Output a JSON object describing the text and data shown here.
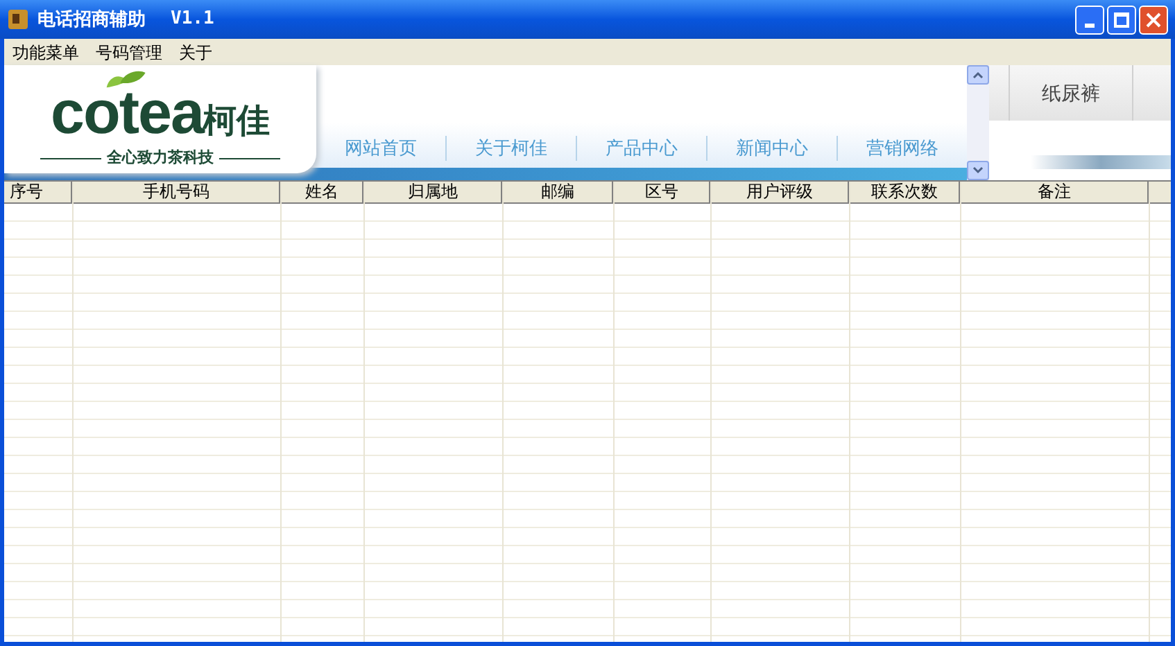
{
  "window": {
    "title": "电话招商辅助",
    "version": "V1.1"
  },
  "menu": [
    "功能菜单",
    "号码管理",
    "关于"
  ],
  "banner": {
    "brand": "cotea",
    "brand_cn": "柯佳",
    "slogan": "全心致力茶科技",
    "nav": [
      "网站首页",
      "关于柯佳",
      "产品中心",
      "新闻中心",
      "营销网络"
    ],
    "side_tab": "纸尿裤"
  },
  "table": {
    "columns": [
      "序号",
      "手机号码",
      "姓名",
      "归属地",
      "邮编",
      "区号",
      "用户评级",
      "联系次数",
      "备注"
    ]
  }
}
